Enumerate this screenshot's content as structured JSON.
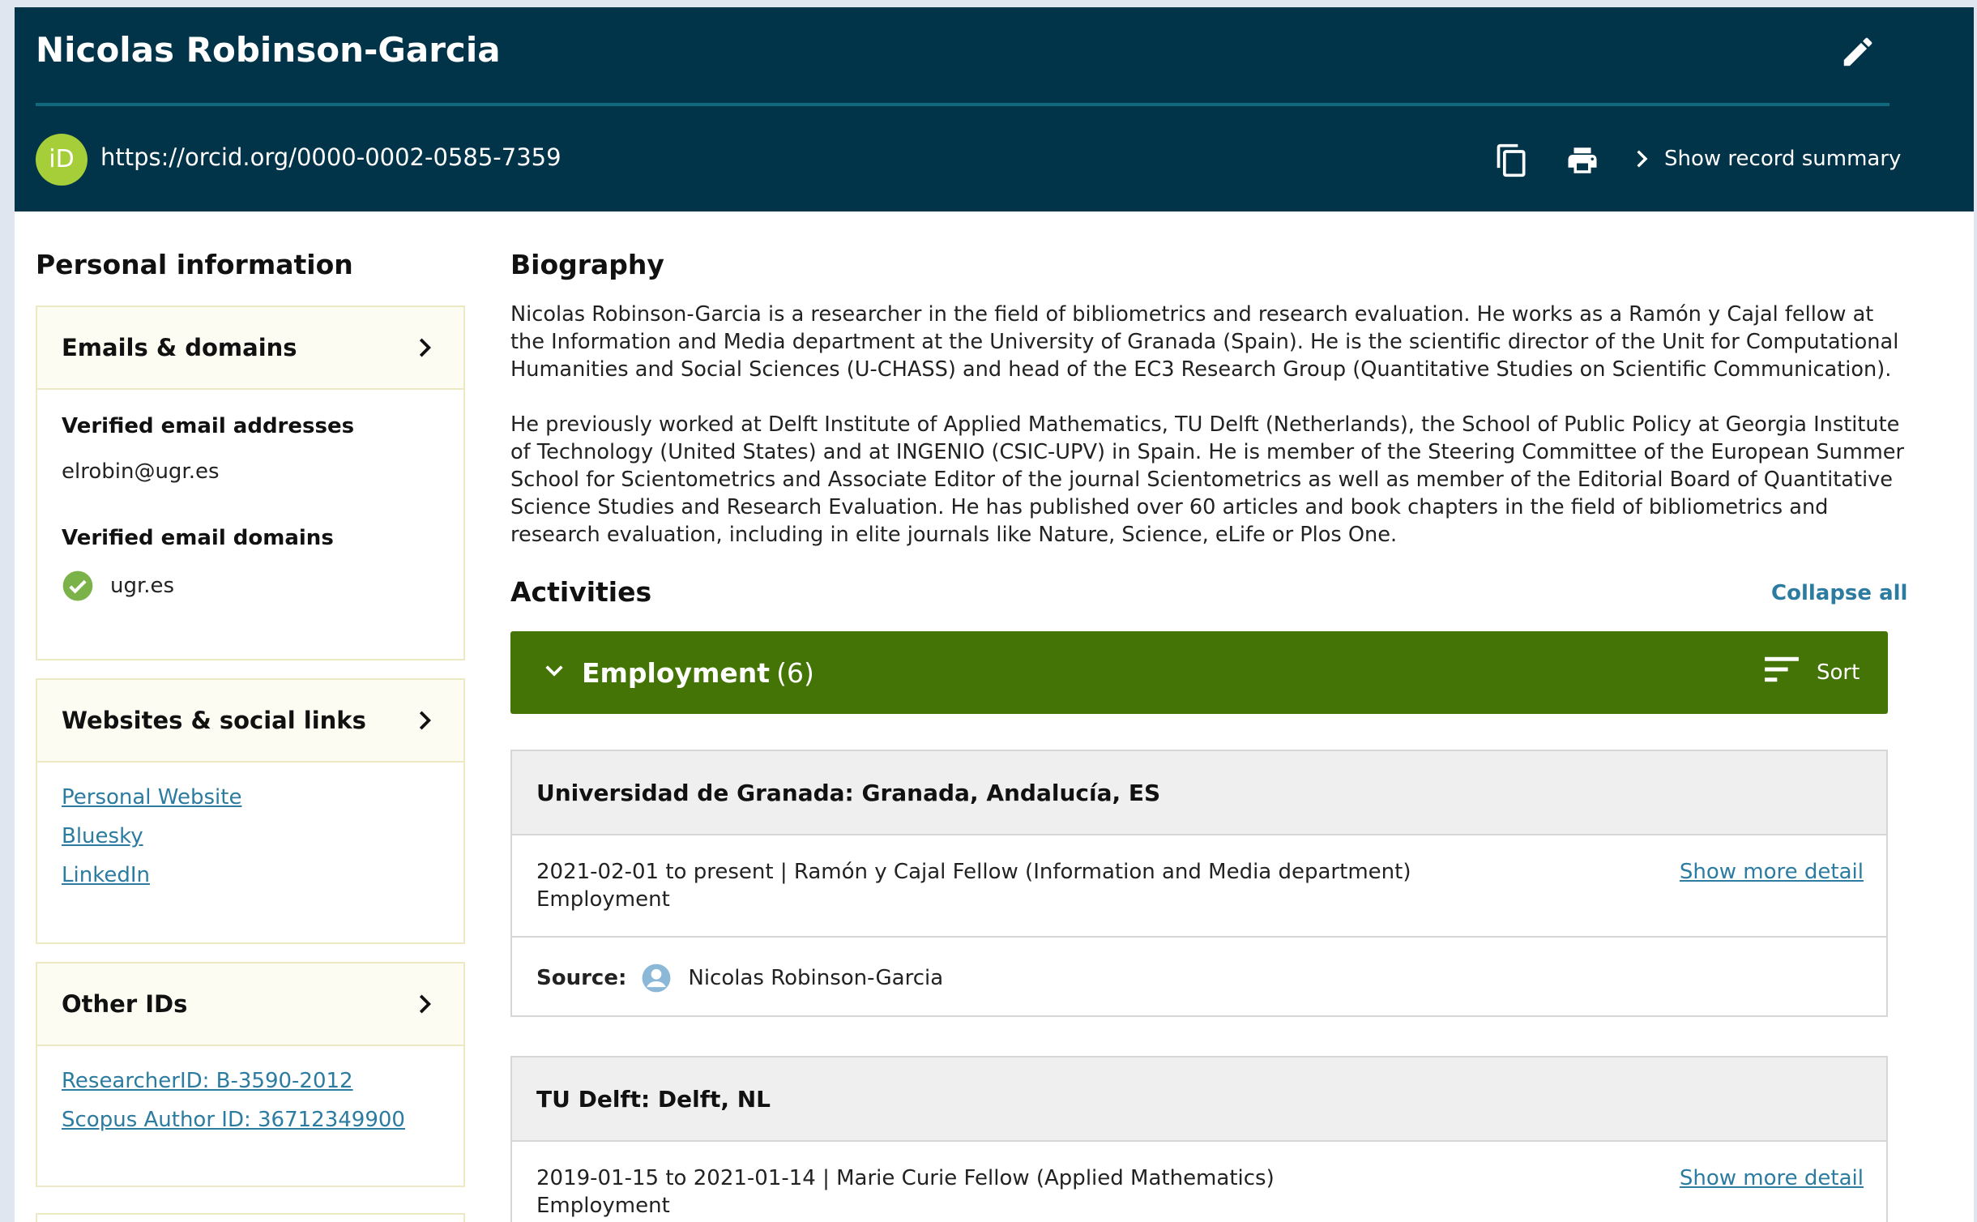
{
  "header": {
    "name": "Nicolas Robinson-Garcia",
    "orcid_badge": "iD",
    "orcid_url": "https://orcid.org/0000-0002-0585-7359",
    "show_summary": "Show record summary"
  },
  "personal": {
    "title": "Personal information",
    "emails": {
      "title": "Emails & domains",
      "verified_addresses_label": "Verified email addresses",
      "address": "elrobin@ugr.es",
      "verified_domains_label": "Verified email domains",
      "domain": "ugr.es"
    },
    "websites": {
      "title": "Websites & social links",
      "links": [
        "Personal Website",
        "Bluesky",
        "LinkedIn"
      ]
    },
    "other_ids": {
      "title": "Other IDs",
      "links": [
        "ResearcherID: B-3590-2012",
        "Scopus Author ID: 36712349900"
      ]
    }
  },
  "biography": {
    "title": "Biography",
    "paragraphs": [
      "Nicolas Robinson-Garcia is a researcher in the field of bibliometrics and research evaluation. He works as a Ramón y Cajal fellow at the Information and Media department at the University of Granada (Spain). He is the scientific director of the Unit for Computational Humanities and Social Sciences (U-CHASS) and head of the EC3 Research Group (Quantitative Studies on Scientific Communication).",
      "He previously worked at Delft Institute of Applied Mathematics, TU Delft (Netherlands), the School of Public Policy at Georgia Institute of Technology (United States) and at INGENIO (CSIC-UPV) in Spain. He is member of the Steering Committee of the European Summer School for Scientometrics and Associate Editor of the journal Scientometrics as well as member of the Editorial Board of Quantitative Science Studies and Research Evaluation. He has published over 60 articles and book chapters in the field of bibliometrics and research evaluation, including in elite journals like Nature, Science, eLife or Plos One."
    ]
  },
  "activities": {
    "title": "Activities",
    "collapse_all": "Collapse all",
    "employment": {
      "title": "Employment",
      "count": "(6)",
      "sort_label": "Sort",
      "entries": [
        {
          "org": "Universidad de Granada: Granada, Andalucía, ES",
          "line1": "2021-02-01 to present | Ramón y Cajal Fellow (Information and Media department)",
          "line2": "Employment",
          "more": "Show more detail",
          "source_label": "Source:",
          "source_name": "Nicolas Robinson-Garcia"
        },
        {
          "org": "TU Delft: Delft, NL",
          "line1": "2019-01-15 to 2021-01-14 | Marie Curie Fellow (Applied Mathematics)",
          "line2": "Employment",
          "more": "Show more detail"
        }
      ]
    }
  },
  "colors": {
    "header_bg": "#013349",
    "employment_bar": "#447405",
    "link": "#2c7ba0",
    "orcid_green": "#a6ce39"
  }
}
